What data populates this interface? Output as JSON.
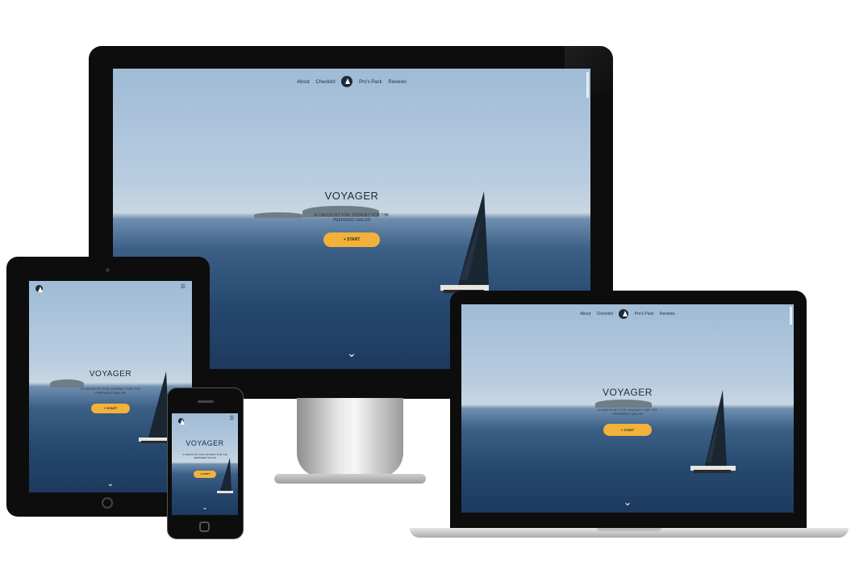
{
  "site": {
    "nav": {
      "left": [
        "About",
        "Checklist"
      ],
      "right": [
        "Pro's Pack",
        "Reviews"
      ]
    },
    "hero": {
      "title": "VOYAGER",
      "subtitle_line1": "A CHECKLIST FOR JOURNEY FOR THE",
      "subtitle_line2": "PREPARED SAILOR",
      "cta": "+ START"
    },
    "icons": {
      "logo": "sailboat-logo-icon",
      "scroll": "chevron-down-icon",
      "menu": "hamburger-menu-icon"
    }
  },
  "colors": {
    "cta": "#f2b23a",
    "bezel": "#0d0d0d",
    "text": "#1f2a38"
  }
}
